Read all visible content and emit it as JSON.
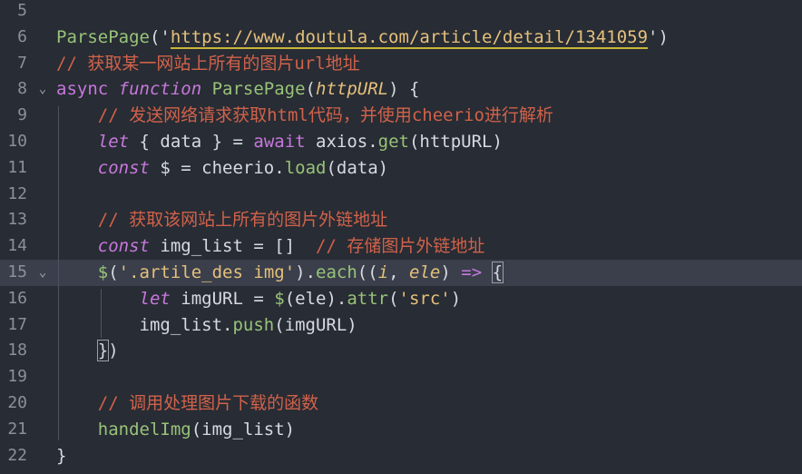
{
  "editor": {
    "lines": [
      {
        "num": "5",
        "tokens": []
      },
      {
        "num": "6",
        "tokens": [
          {
            "t": "ParsePage",
            "c": "fn"
          },
          {
            "t": "('",
            "c": "pl"
          },
          {
            "t": "https://www.doutula.com/article/detail/1341059",
            "c": "url"
          },
          {
            "t": "')",
            "c": "pl"
          }
        ]
      },
      {
        "num": "7",
        "tokens": [
          {
            "t": "// 获取某一网站上所有的图片url地址",
            "c": "cm"
          }
        ]
      },
      {
        "num": "8",
        "fold": "⌄",
        "tokens": [
          {
            "t": "async ",
            "c": "kw"
          },
          {
            "t": "function ",
            "c": "kwi"
          },
          {
            "t": "ParsePage",
            "c": "fn"
          },
          {
            "t": "(",
            "c": "pl"
          },
          {
            "t": "httpURL",
            "c": "par"
          },
          {
            "t": ") {",
            "c": "pl"
          }
        ]
      },
      {
        "num": "9",
        "tokens": [
          {
            "t": "    // 发送网络请求获取html代码，并使用cheerio进行解析",
            "c": "cm"
          }
        ]
      },
      {
        "num": "10",
        "tokens": [
          {
            "t": "    ",
            "c": "pl"
          },
          {
            "t": "let",
            "c": "kwi"
          },
          {
            "t": " { data } = ",
            "c": "pl"
          },
          {
            "t": "await",
            "c": "kw"
          },
          {
            "t": " axios.",
            "c": "pl"
          },
          {
            "t": "get",
            "c": "fn"
          },
          {
            "t": "(httpURL)",
            "c": "pl"
          }
        ]
      },
      {
        "num": "11",
        "tokens": [
          {
            "t": "    ",
            "c": "pl"
          },
          {
            "t": "const",
            "c": "kwi"
          },
          {
            "t": " $ = cheerio.",
            "c": "pl"
          },
          {
            "t": "load",
            "c": "fn"
          },
          {
            "t": "(data)",
            "c": "pl"
          }
        ]
      },
      {
        "num": "12",
        "tokens": []
      },
      {
        "num": "13",
        "tokens": [
          {
            "t": "    // 获取该网站上所有的图片外链地址",
            "c": "cm"
          }
        ]
      },
      {
        "num": "14",
        "tokens": [
          {
            "t": "    ",
            "c": "pl"
          },
          {
            "t": "const",
            "c": "kwi"
          },
          {
            "t": " img_list = []  ",
            "c": "pl"
          },
          {
            "t": "// 存储图片外链地址",
            "c": "cm"
          }
        ]
      },
      {
        "num": "15",
        "fold": "⌄",
        "current": true,
        "tokens": [
          {
            "t": "    ",
            "c": "pl"
          },
          {
            "t": "$",
            "c": "fn"
          },
          {
            "t": "(",
            "c": "pl"
          },
          {
            "t": "'.artile_des img'",
            "c": "str"
          },
          {
            "t": ").",
            "c": "pl"
          },
          {
            "t": "each",
            "c": "fn"
          },
          {
            "t": "((",
            "c": "pl"
          },
          {
            "t": "i",
            "c": "par"
          },
          {
            "t": ", ",
            "c": "pl"
          },
          {
            "t": "ele",
            "c": "par"
          },
          {
            "t": ") ",
            "c": "pl"
          },
          {
            "t": "=>",
            "c": "kw"
          },
          {
            "t": " ",
            "c": "pl"
          },
          {
            "t": "{",
            "c": "pl bm"
          }
        ]
      },
      {
        "num": "16",
        "tokens": [
          {
            "t": "        ",
            "c": "pl"
          },
          {
            "t": "let",
            "c": "kwi"
          },
          {
            "t": " imgURL = ",
            "c": "pl"
          },
          {
            "t": "$",
            "c": "fn"
          },
          {
            "t": "(ele).",
            "c": "pl"
          },
          {
            "t": "attr",
            "c": "fn"
          },
          {
            "t": "(",
            "c": "pl"
          },
          {
            "t": "'src'",
            "c": "str"
          },
          {
            "t": ")",
            "c": "pl"
          }
        ]
      },
      {
        "num": "17",
        "tokens": [
          {
            "t": "        img_list.",
            "c": "pl"
          },
          {
            "t": "push",
            "c": "fn"
          },
          {
            "t": "(imgURL)",
            "c": "pl"
          }
        ]
      },
      {
        "num": "18",
        "tokens": [
          {
            "t": "    ",
            "c": "pl"
          },
          {
            "t": "}",
            "c": "pl bm"
          },
          {
            "t": ")",
            "c": "pl"
          }
        ]
      },
      {
        "num": "19",
        "tokens": []
      },
      {
        "num": "20",
        "tokens": [
          {
            "t": "    // 调用处理图片下载的函数",
            "c": "cm"
          }
        ]
      },
      {
        "num": "21",
        "tokens": [
          {
            "t": "    ",
            "c": "pl"
          },
          {
            "t": "handelImg",
            "c": "fn"
          },
          {
            "t": "(img_list)",
            "c": "pl"
          }
        ]
      },
      {
        "num": "22",
        "tokens": [
          {
            "t": "}",
            "c": "pl"
          }
        ]
      }
    ]
  }
}
